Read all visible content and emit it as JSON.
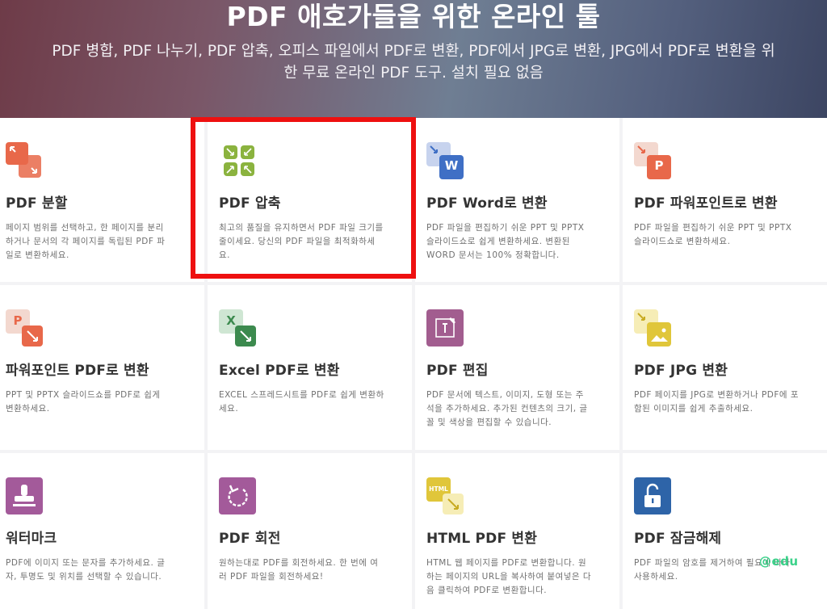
{
  "hero": {
    "title": "PDF 애호가들을 위한 온라인 툴",
    "subtitle": "PDF 병합, PDF 나누기, PDF 압축, 오피스 파일에서 PDF로 변환, PDF에서 JPG로 변환, JPG에서 PDF로 변환을 위한 무료 온라인 PDF 도구. 설치 필요 없음"
  },
  "tools": [
    {
      "title": "PDF 분할",
      "desc": "페이지 범위를 선택하고, 한 페이지를 분리하거나 문서의 각 페이지를 독립된 PDF 파일로 변환하세요.",
      "icon": "split-icon"
    },
    {
      "title": "PDF 압축",
      "desc": "최고의 품질을 유지하면서 PDF 파일 크기를 줄이세요. 당신의 PDF 파일을 최적화하세요.",
      "icon": "compress-icon"
    },
    {
      "title": "PDF Word로 변환",
      "desc": "PDF 파일을 편집하기 쉬운 PPT 및 PPTX 슬라이드쇼로 쉽게 변환하세요. 변환된 WORD 문서는 100% 정확합니다.",
      "icon": "word-icon"
    },
    {
      "title": "PDF 파워포인트로 변환",
      "desc": "PDF 파일을 편집하기 쉬운 PPT 및 PPTX 슬라이드쇼로 변환하세요.",
      "icon": "powerpoint-icon"
    },
    {
      "title": "파워포인트 PDF로 변환",
      "desc": "PPT 및 PPTX 슬라이드쇼를 PDF로 쉽게 변환하세요.",
      "icon": "ppt-to-pdf-icon"
    },
    {
      "title": "Excel PDF로 변환",
      "desc": "EXCEL 스프레드시트를 PDF로 쉽게 변환하세요.",
      "icon": "excel-icon"
    },
    {
      "title": "PDF 편집",
      "desc": "PDF 문서에 텍스트, 이미지, 도형 또는 주석을 추가하세요. 추가된 컨텐츠의 크기, 글꼴 및 색상을 편집할 수 있습니다.",
      "icon": "edit-icon"
    },
    {
      "title": "PDF JPG 변환",
      "desc": "PDF 페이지를 JPG로 변환하거나 PDF에 포함된 이미지를 쉽게 추출하세요.",
      "icon": "jpg-icon"
    },
    {
      "title": "워터마크",
      "desc": "PDF에 이미지 또는 문자를 추가하세요. 글자, 투명도 및 위치를 선택할 수 있습니다.",
      "icon": "stamp-icon"
    },
    {
      "title": "PDF 회전",
      "desc": "원하는대로 PDF를 회전하세요. 한 번에 여러 PDF 파일을 회전하세요!",
      "icon": "rotate-icon"
    },
    {
      "title": "HTML PDF 변환",
      "desc": "HTML 웹 페이지를 PDF로 변환합니다. 원하는 페이지의 URL을 복사하여 붙여넣은 다음 클릭하여 PDF로 변환합니다.",
      "icon": "html-icon"
    },
    {
      "title": "PDF 잠금해제",
      "desc": "PDF 파일의 암호를 제거하여 필요에 따라 사용하세요.",
      "icon": "unlock-icon"
    }
  ],
  "icon_labels": {
    "word": "W",
    "powerpoint": "P",
    "ppt_to_pdf": "P",
    "excel": "X",
    "html": "HTML"
  },
  "watermark": "@edu",
  "colors": {
    "highlight": "#ee1010",
    "split": "#e8684a",
    "compress": "#8bb33f",
    "word": "#3f6fc5",
    "excel": "#3c8a4e",
    "edit": "#a25d8f",
    "jpg": "#e0c63a",
    "stamp": "#a35a9a",
    "unlock": "#2e64a8"
  }
}
